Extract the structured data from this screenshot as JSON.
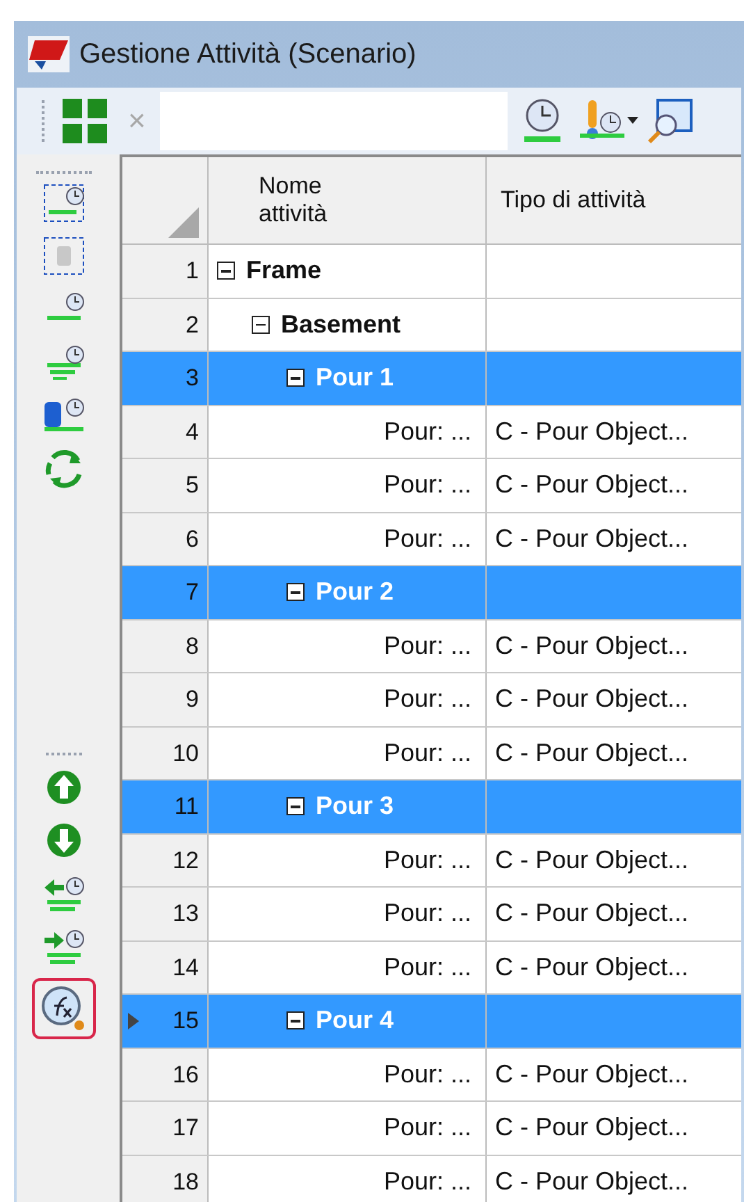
{
  "window": {
    "title": "Gestione Attività (Scenario)"
  },
  "toolbar": {
    "close": "×"
  },
  "table": {
    "columns": [
      "Nome attività",
      "Tipo di attività"
    ],
    "rows": [
      {
        "number": "1",
        "name": "Frame",
        "expanded": true,
        "selected": false,
        "current": false,
        "children": [
          {
            "number": "2",
            "name": "Basement",
            "expanded": true,
            "selected": false,
            "current": false,
            "children": [
              {
                "number": "3",
                "name": "Pour 1",
                "expanded": true,
                "selected": true,
                "current": false,
                "children": [
                  {
                    "number": "4",
                    "name": "Pour: ...",
                    "type": "C - Pour Object...",
                    "selected": false,
                    "current": false
                  },
                  {
                    "number": "5",
                    "name": "Pour: ...",
                    "type": "C - Pour Object...",
                    "selected": false,
                    "current": false
                  },
                  {
                    "number": "6",
                    "name": "Pour: ...",
                    "type": "C - Pour Object...",
                    "selected": false,
                    "current": false
                  }
                ]
              },
              {
                "number": "7",
                "name": "Pour 2",
                "expanded": true,
                "selected": true,
                "current": false,
                "children": [
                  {
                    "number": "8",
                    "name": "Pour: ...",
                    "type": "C - Pour Object...",
                    "selected": false,
                    "current": false
                  },
                  {
                    "number": "9",
                    "name": "Pour: ...",
                    "type": "C - Pour Object...",
                    "selected": false,
                    "current": false
                  },
                  {
                    "number": "10",
                    "name": "Pour: ...",
                    "type": "C - Pour Object...",
                    "selected": false,
                    "current": false
                  }
                ]
              },
              {
                "number": "11",
                "name": "Pour 3",
                "expanded": true,
                "selected": true,
                "current": false,
                "children": [
                  {
                    "number": "12",
                    "name": "Pour: ...",
                    "type": "C - Pour Object...",
                    "selected": false,
                    "current": false
                  },
                  {
                    "number": "13",
                    "name": "Pour: ...",
                    "type": "C - Pour Object...",
                    "selected": false,
                    "current": false
                  },
                  {
                    "number": "14",
                    "name": "Pour: ...",
                    "type": "C - Pour Object...",
                    "selected": false,
                    "current": false
                  }
                ]
              },
              {
                "number": "15",
                "name": "Pour 4",
                "expanded": true,
                "selected": true,
                "current": true,
                "children": [
                  {
                    "number": "16",
                    "name": "Pour: ...",
                    "type": "C - Pour Object...",
                    "selected": false,
                    "current": false
                  },
                  {
                    "number": "17",
                    "name": "Pour: ...",
                    "type": "C - Pour Object...",
                    "selected": false,
                    "current": false
                  },
                  {
                    "number": "18",
                    "name": "Pour: ...",
                    "type": "C - Pour Object...",
                    "selected": false,
                    "current": false
                  }
                ]
              }
            ]
          }
        ]
      }
    ]
  }
}
